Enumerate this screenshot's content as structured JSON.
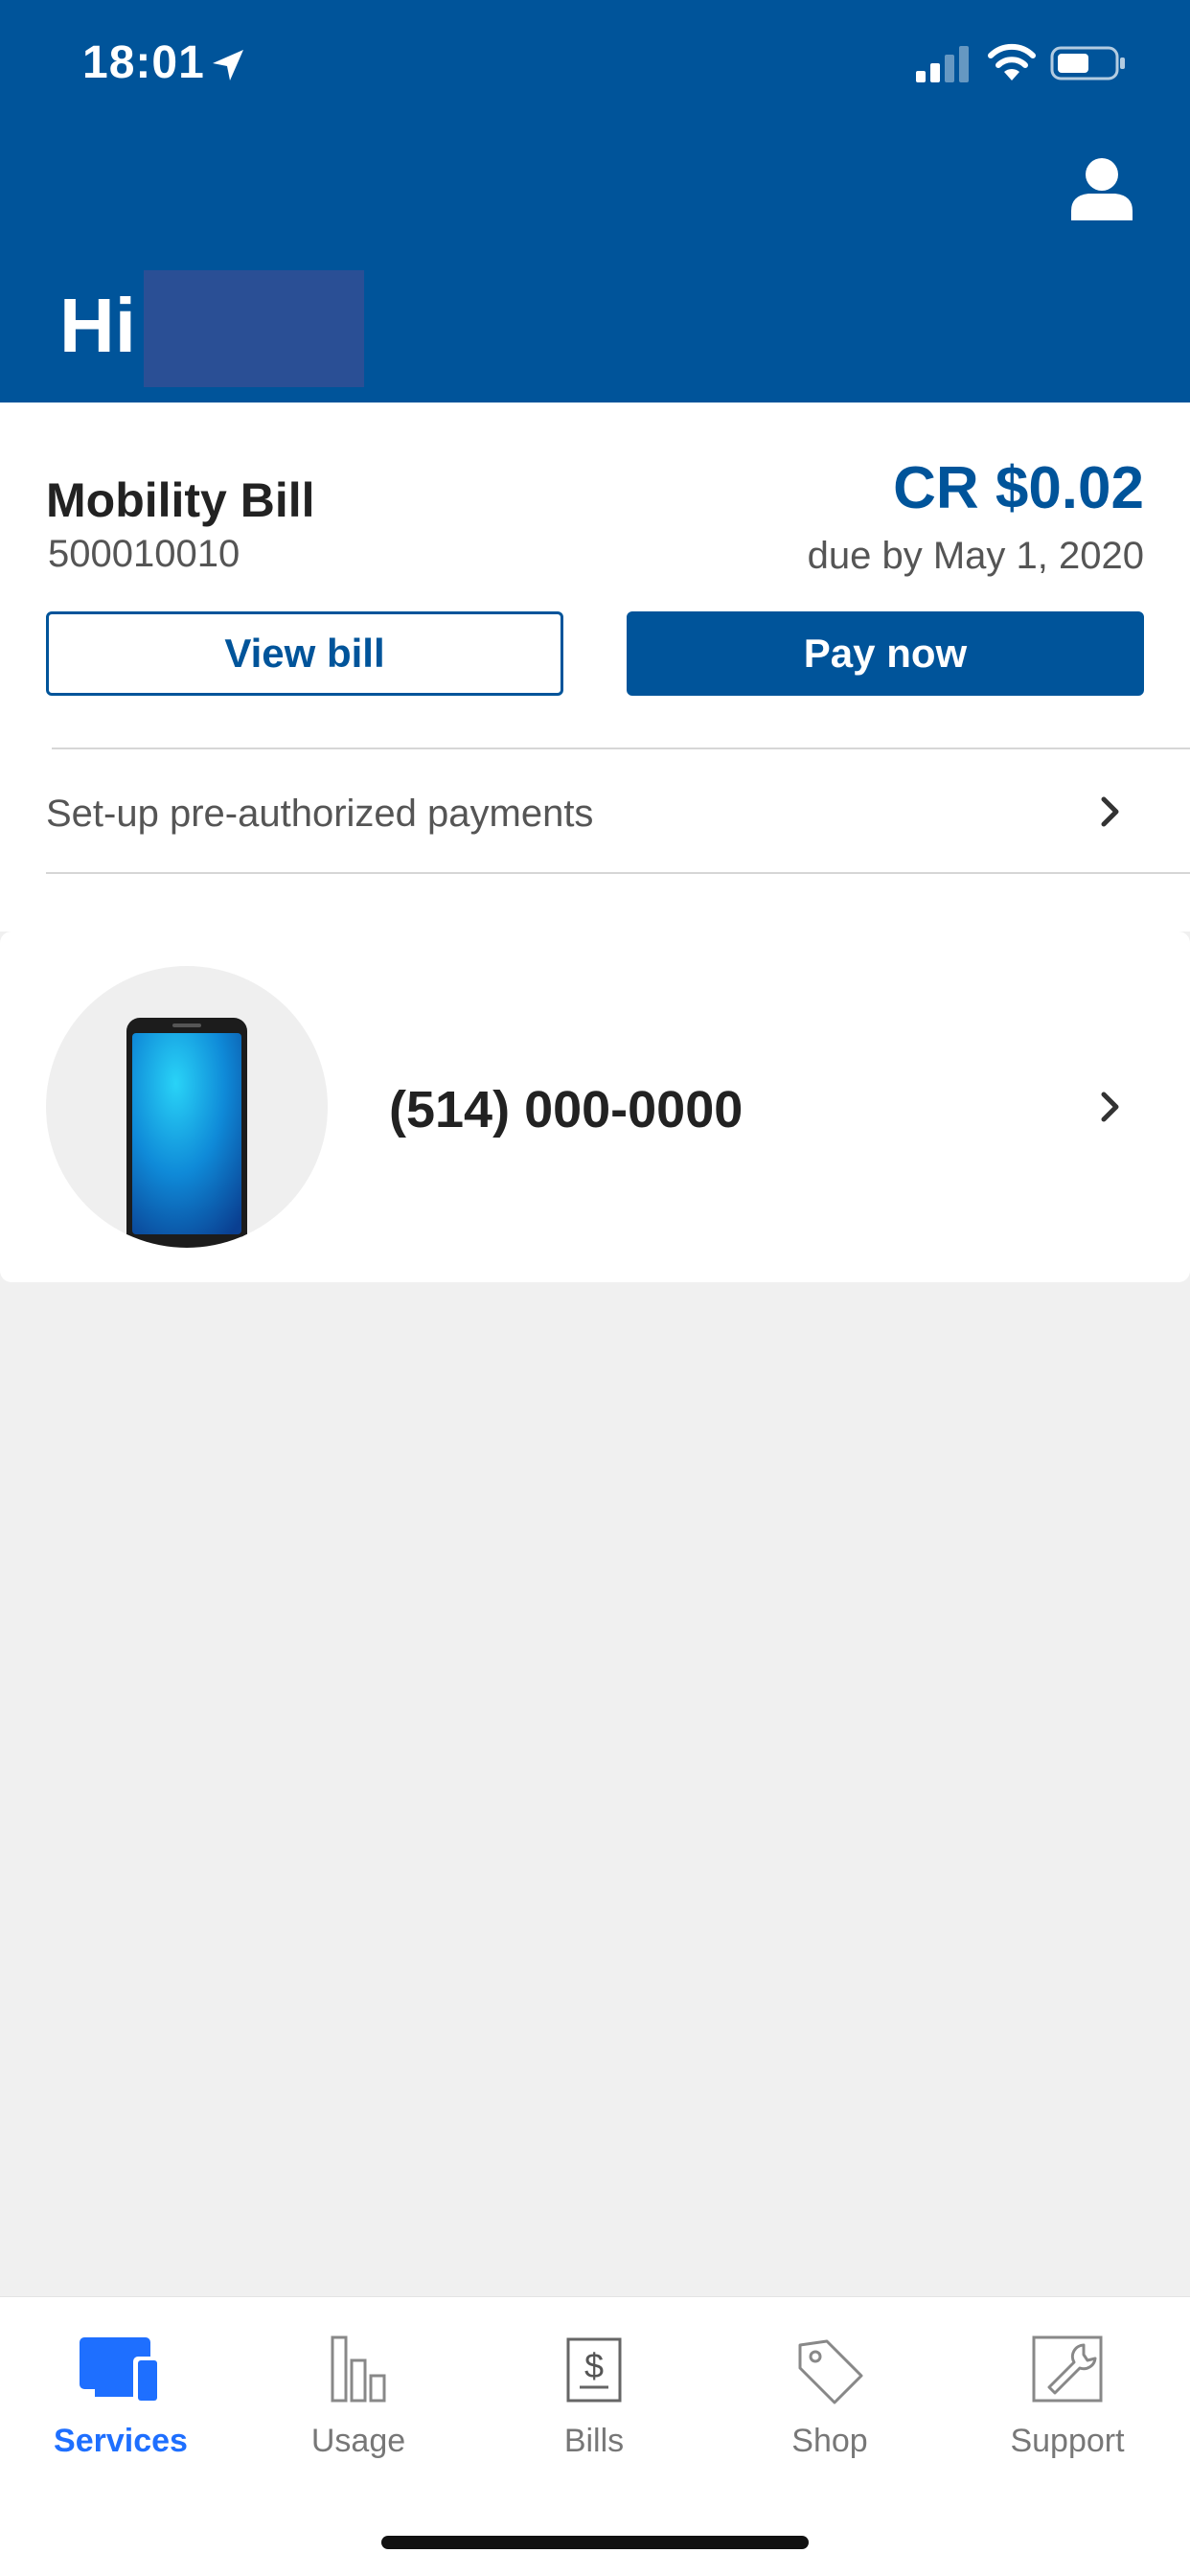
{
  "status_bar": {
    "time": "18:01"
  },
  "header": {
    "greeting": "Hi"
  },
  "bill": {
    "title": "Mobility Bill",
    "account_number": "500010010",
    "amount": "CR $0.02",
    "due": "due by May 1, 2020",
    "view_bill_label": "View bill",
    "pay_now_label": "Pay now",
    "preauth_label": "Set-up pre-authorized payments"
  },
  "line": {
    "phone_number": "(514) 000-0000"
  },
  "tabs": [
    {
      "label": "Services",
      "icon": "services-icon",
      "active": true
    },
    {
      "label": "Usage",
      "icon": "usage-icon",
      "active": false
    },
    {
      "label": "Bills",
      "icon": "bills-icon",
      "active": false
    },
    {
      "label": "Shop",
      "icon": "shop-icon",
      "active": false
    },
    {
      "label": "Support",
      "icon": "support-icon",
      "active": false
    }
  ],
  "colors": {
    "brand": "#00549a",
    "active_tab": "#1e6fff",
    "background": "#f0f0f0"
  }
}
